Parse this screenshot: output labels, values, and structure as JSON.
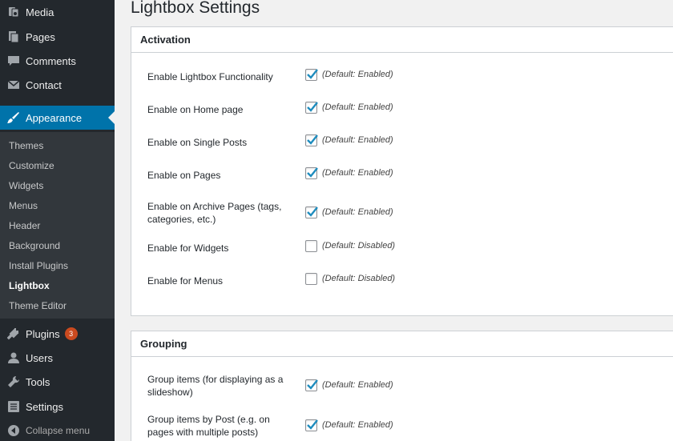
{
  "sidebar": {
    "top_items": [
      {
        "label": "Media",
        "icon": "media-icon"
      },
      {
        "label": "Pages",
        "icon": "pages-icon"
      },
      {
        "label": "Comments",
        "icon": "comments-icon"
      },
      {
        "label": "Contact",
        "icon": "contact-icon"
      }
    ],
    "appearance_label": "Appearance",
    "submenu": [
      "Themes",
      "Customize",
      "Widgets",
      "Menus",
      "Header",
      "Background",
      "Install Plugins",
      "Lightbox",
      "Theme Editor"
    ],
    "bottom_items": [
      {
        "label": "Plugins",
        "icon": "plugins-icon",
        "badge": "3"
      },
      {
        "label": "Users",
        "icon": "users-icon"
      },
      {
        "label": "Tools",
        "icon": "tools-icon"
      },
      {
        "label": "Settings",
        "icon": "settings-icon"
      }
    ],
    "collapse_label": "Collapse menu",
    "accent_color": "#0073aa"
  },
  "page_title": "Lightbox Settings",
  "activation": {
    "heading": "Activation",
    "rows": [
      {
        "label": "Enable Lightbox Functionality",
        "checked": true,
        "hint": "(Default: Enabled)"
      },
      {
        "label": "Enable on Home page",
        "checked": true,
        "hint": "(Default: Enabled)"
      },
      {
        "label": "Enable on Single Posts",
        "checked": true,
        "hint": "(Default: Enabled)"
      },
      {
        "label": "Enable on Pages",
        "checked": true,
        "hint": "(Default: Enabled)"
      },
      {
        "label": "Enable on Archive Pages (tags, categories, etc.)",
        "checked": true,
        "hint": "(Default: Enabled)"
      },
      {
        "label": "Enable for Widgets",
        "checked": false,
        "hint": "(Default: Disabled)"
      },
      {
        "label": "Enable for Menus",
        "checked": false,
        "hint": "(Default: Disabled)"
      }
    ]
  },
  "grouping": {
    "heading": "Grouping",
    "rows": [
      {
        "label": "Group items (for displaying as a slideshow)",
        "checked": true,
        "hint": "(Default: Enabled)"
      },
      {
        "label": "Group items by Post (e.g. on pages with multiple posts)",
        "checked": true,
        "hint": "(Default: Enabled)"
      }
    ]
  }
}
